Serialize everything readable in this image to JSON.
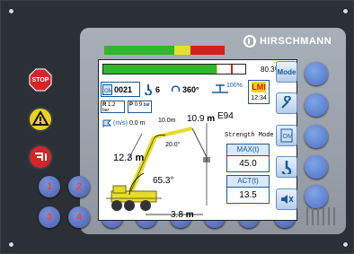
{
  "brand": "HIRSCHMANN",
  "status_lights": {
    "colors": [
      "#2fb52f",
      "#e5e02a",
      "#d51e1e"
    ],
    "shares": [
      0.58,
      0.14,
      0.28
    ]
  },
  "screen": {
    "load_percent_label": "80.3%",
    "load_fraction": 0.803,
    "load_colors": [
      "#2fb52f",
      "#e5e02a",
      "#d51e1e"
    ],
    "hook_code": "0021",
    "reeving": "6",
    "slew": "360°",
    "wind_percent": "100%",
    "lmi_label": "LMI",
    "clock": "12:34",
    "radius_indicator": {
      "label": "R",
      "value": "1.2",
      "unit": "bar"
    },
    "pressure_indicator": {
      "label": "P",
      "value": "0.9",
      "unit": "bar"
    },
    "error_code": "E94",
    "wind": {
      "label": "(m/s)",
      "value": "0.0",
      "unit": "m"
    },
    "jib_length": "10.0m",
    "head_height": "10.9",
    "jib_angle": "20.0°",
    "boom_length": "12.3",
    "boom_angle": "65.3°",
    "radius": "3.8",
    "unit_m": "m",
    "mode": "Strength Mode",
    "max": {
      "label": "MAX(t)",
      "value": "45.0"
    },
    "act": {
      "label": "ACT(t)",
      "value": "13.5"
    }
  },
  "side_buttons": [
    "Mode",
    "wrench-icon",
    "hook-memory-icon",
    "hook-icon",
    "speaker-icon"
  ],
  "left_controls": [
    "STOP",
    "warning-icon",
    "reset-icon"
  ],
  "number_keys": [
    "1",
    "2",
    "3",
    "4",
    "5",
    "6",
    "7",
    "8",
    "9",
    "0"
  ],
  "colors": {
    "accent": "#1b5a9a",
    "error": "#d21a1a",
    "boom": "#e6dc2a"
  }
}
